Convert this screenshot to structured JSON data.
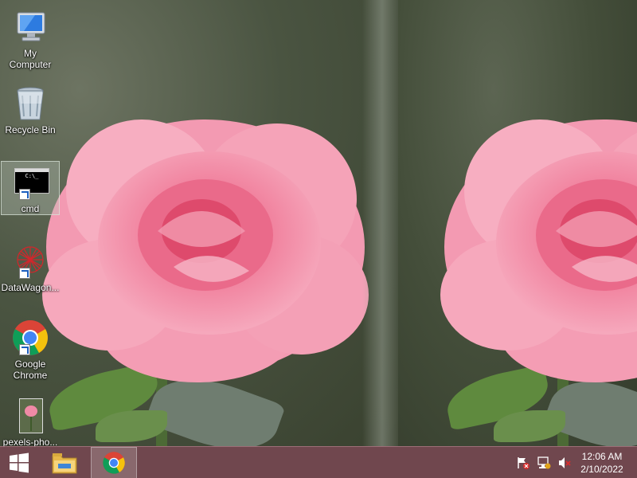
{
  "desktop": {
    "icons": [
      {
        "label": "My\nComputer"
      },
      {
        "label": "Recycle Bin"
      },
      {
        "label": "cmd",
        "thumb_text": "C:\\_"
      },
      {
        "label": "DataWagon..."
      },
      {
        "label": "Google\nChrome"
      },
      {
        "label": "pexels-pho..."
      }
    ]
  },
  "taskbar": {
    "clock": {
      "time": "12:06 AM",
      "date": "2/10/2022"
    }
  },
  "colors": {
    "taskbar": "#744650",
    "accent": "#1d5fbf",
    "rose": "#ef8fa8"
  }
}
